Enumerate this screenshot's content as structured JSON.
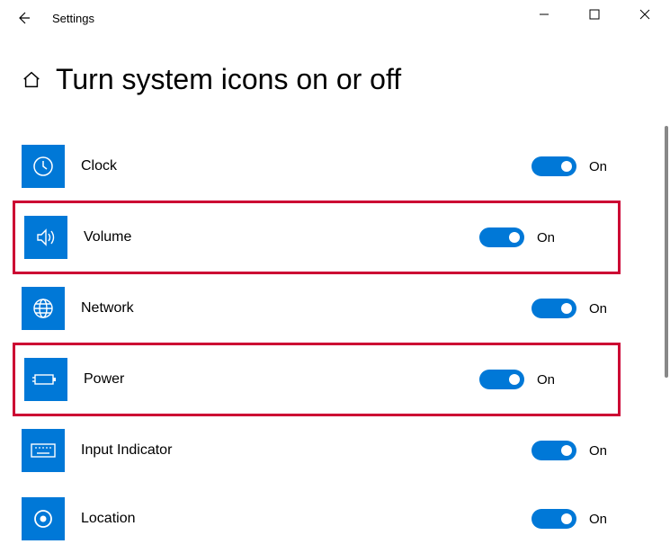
{
  "window": {
    "app_title": "Settings"
  },
  "page": {
    "title": "Turn system icons on or off"
  },
  "items": [
    {
      "label": "Clock",
      "state_label": "On",
      "icon": "clock",
      "highlighted": false
    },
    {
      "label": "Volume",
      "state_label": "On",
      "icon": "volume",
      "highlighted": true
    },
    {
      "label": "Network",
      "state_label": "On",
      "icon": "network",
      "highlighted": false
    },
    {
      "label": "Power",
      "state_label": "On",
      "icon": "power",
      "highlighted": true
    },
    {
      "label": "Input Indicator",
      "state_label": "On",
      "icon": "keyboard",
      "highlighted": false
    },
    {
      "label": "Location",
      "state_label": "On",
      "icon": "location",
      "highlighted": false
    }
  ],
  "colors": {
    "accent": "#0078d7",
    "highlight_border": "#cc0033"
  }
}
